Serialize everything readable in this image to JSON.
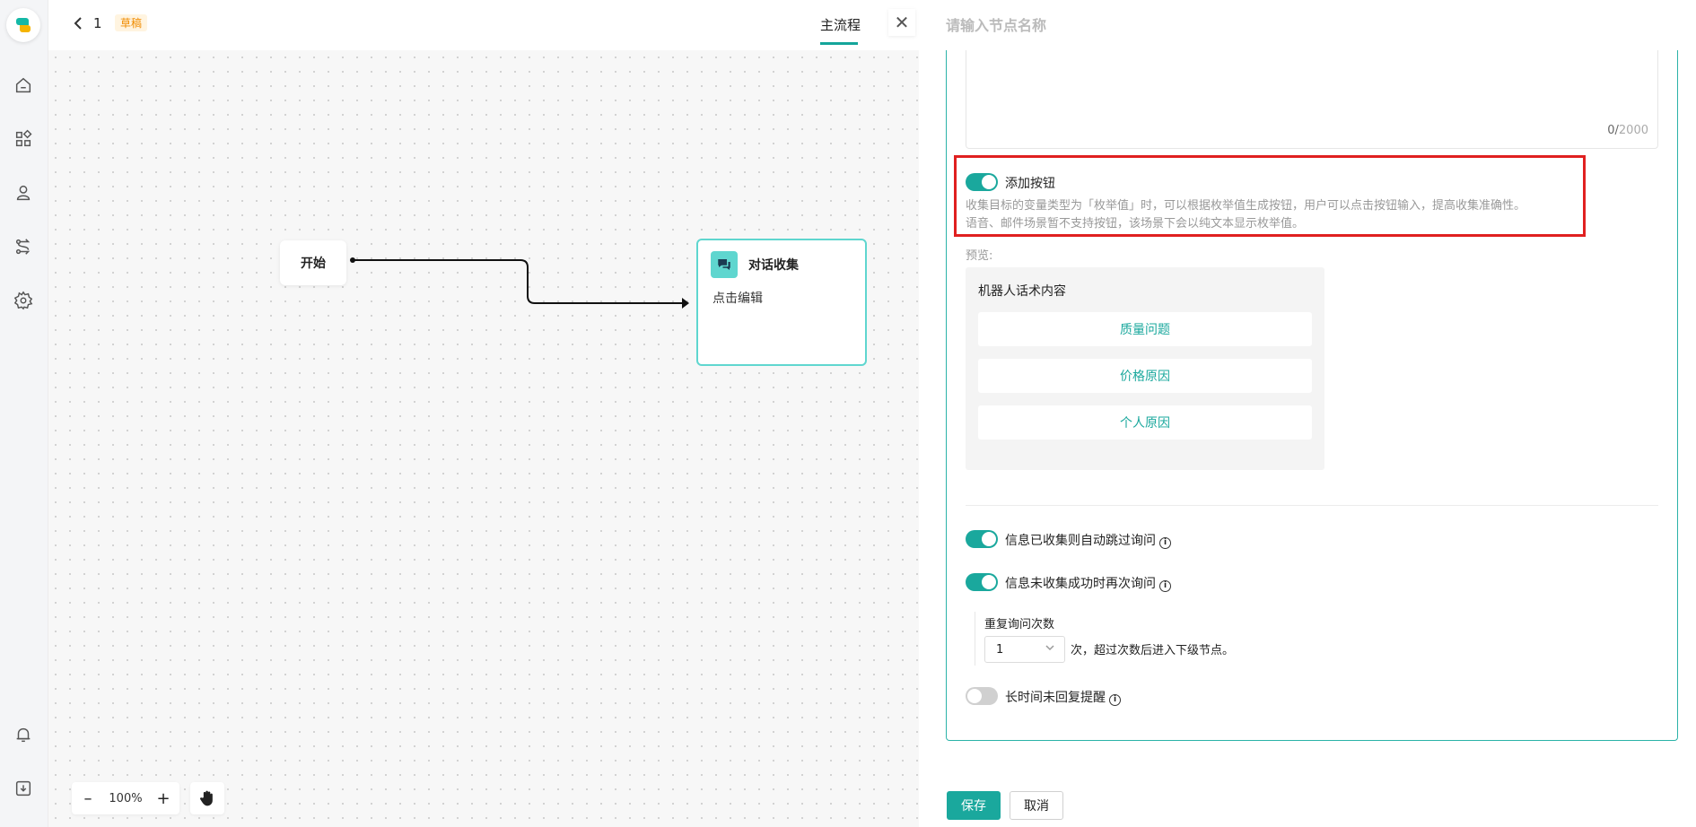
{
  "sidebar": {
    "icons": [
      "home-icon",
      "apps-icon",
      "user-bag-icon",
      "flow-icon",
      "gear-icon",
      "bell-icon",
      "download-icon"
    ]
  },
  "topbar": {
    "flow_name": "1",
    "status_badge": "草稿",
    "tab_main": "主流程"
  },
  "canvas": {
    "start_node": "开始",
    "collect_node": {
      "title": "对话收集",
      "subtitle": "点击编辑"
    },
    "zoom": "100%",
    "zoom_out": "–",
    "zoom_in": "+"
  },
  "panel": {
    "close": "✕",
    "node_name_placeholder": "请输入节点名称",
    "counter_current": "0/",
    "counter_max": "2000",
    "add_button": {
      "label": "添加按钮",
      "enabled": true,
      "desc_line1": "收集目标的变量类型为「枚举值」时，可以根据枚举值生成按钮，用户可以点击按钮输入，提高收集准确性。",
      "desc_line2": "语音、邮件场景暂不支持按钮，该场景下会以纯文本显示枚举值。"
    },
    "preview": {
      "label": "预览:",
      "bot_text": "机器人话术内容",
      "options": [
        "质量问题",
        "价格原因",
        "个人原因"
      ]
    },
    "skip_if_collected": {
      "label": "信息已收集则自动跳过询问",
      "enabled": true
    },
    "reask_on_fail": {
      "label": "信息未收集成功时再次询问",
      "enabled": true
    },
    "repeat": {
      "label": "重复询问次数",
      "value": "1",
      "suffix": "次，超过次数后进入下级节点。"
    },
    "no_reply_reminder": {
      "label": "长时间未回复提醒",
      "enabled": false
    }
  },
  "footer": {
    "save": "保存",
    "cancel": "取消"
  },
  "colors": {
    "accent": "#1aa89d",
    "highlight": "#e02020",
    "draft": "#f08c00"
  }
}
